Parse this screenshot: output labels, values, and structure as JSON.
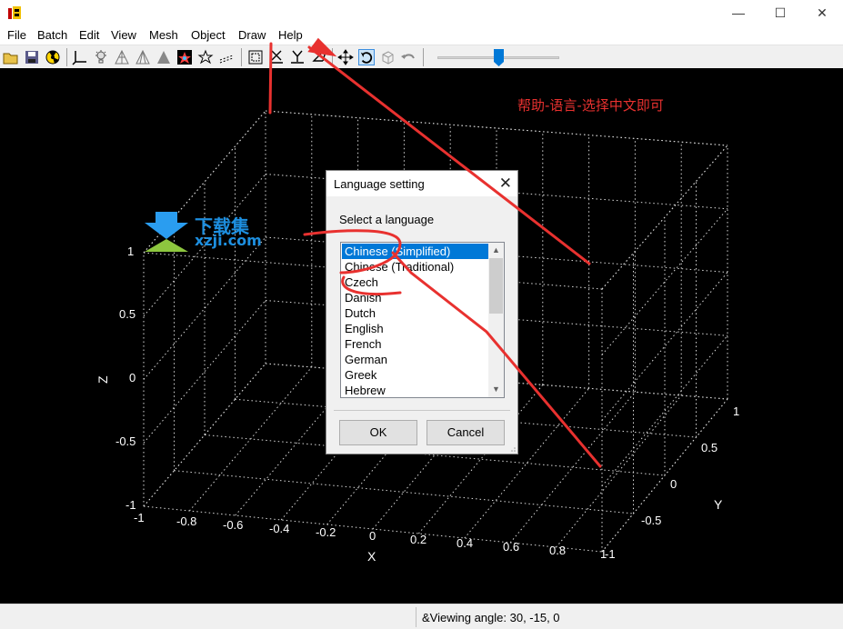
{
  "window": {
    "minimize_glyph": "—",
    "maximize_glyph": "☐",
    "close_glyph": "✕"
  },
  "menu": [
    "File",
    "Batch",
    "Edit",
    "View",
    "Mesh",
    "Object",
    "Draw",
    "Help"
  ],
  "toolbar": {
    "icons": [
      "open-icon",
      "save-icon",
      "radiation-icon",
      "axes-icon",
      "light-icon",
      "mesh-icon",
      "wireframe-icon",
      "shaded-icon",
      "color-icon",
      "star-icon",
      "dots-icon",
      "bounding-box-icon",
      "x-axis-icon",
      "y-axis-icon",
      "z-axis-icon",
      "move-icon",
      "rotate-icon",
      "cube-icon",
      "undo-icon"
    ],
    "slider_value_percent": 50
  },
  "annotation": "帮助-语言-选择中文即可",
  "watermark": {
    "cn": "下载集",
    "url": "xzji.com"
  },
  "dialog": {
    "title": "Language setting",
    "close_glyph": "✕",
    "prompt": "Select a language",
    "languages": [
      "Chinese (Simplified)",
      "Chinese (Traditional)",
      "Czech",
      "Danish",
      "Dutch",
      "English",
      "French",
      "German",
      "Greek",
      "Hebrew"
    ],
    "selected_index": 0,
    "ok_label": "OK",
    "cancel_label": "Cancel"
  },
  "plot": {
    "z_ticks": [
      "1",
      "0.5",
      "0",
      "-0.5",
      "-1"
    ],
    "x_ticks": [
      "-1",
      "-0.8",
      "-0.6",
      "-0.4",
      "-0.2",
      "0",
      "0.2",
      "0.4",
      "0.6",
      "0.8",
      "1"
    ],
    "y_ticks": [
      "-1",
      "-0.5",
      "0",
      "0.5",
      "1"
    ],
    "x_label": "X",
    "y_label": "Y",
    "z_label": "Z"
  },
  "status": {
    "text": "&Viewing angle: 30, -15, 0"
  },
  "colors": {
    "annotation": "#e8312f",
    "selection": "#0078d7",
    "watermark": "#1d8fe0"
  }
}
